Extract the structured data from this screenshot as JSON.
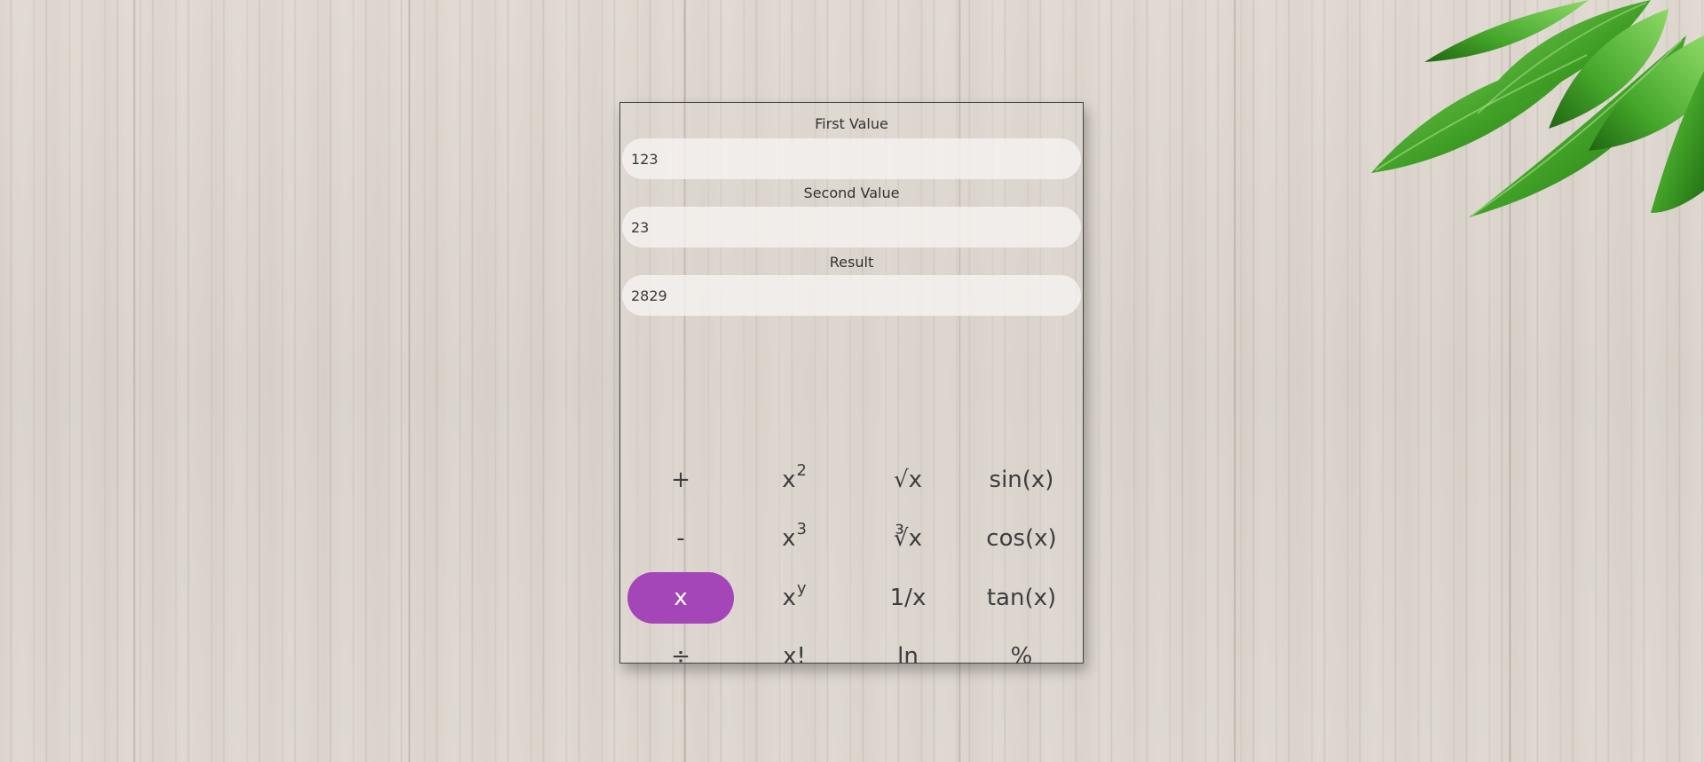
{
  "form": {
    "first_label": "First Value",
    "first_value": "123",
    "second_label": "Second Value",
    "second_value": "23",
    "result_label": "Result",
    "result_value": "2829"
  },
  "operations": [
    {
      "label": "+",
      "sup": ""
    },
    {
      "label": "x",
      "sup": "2"
    },
    {
      "label": "√x",
      "sup": ""
    },
    {
      "label": "sin(x)",
      "sup": ""
    },
    {
      "label": "-",
      "sup": ""
    },
    {
      "label": "x",
      "sup": "3"
    },
    {
      "label": "∛x",
      "sup": ""
    },
    {
      "label": "cos(x)",
      "sup": ""
    },
    {
      "label": "x",
      "sup": ""
    },
    {
      "label": "x",
      "sup": "y"
    },
    {
      "label": "1/x",
      "sup": ""
    },
    {
      "label": "tan(x)",
      "sup": ""
    },
    {
      "label": "÷",
      "sup": ""
    },
    {
      "label": "x!",
      "sup": ""
    },
    {
      "label": "ln",
      "sup": ""
    },
    {
      "label": "%",
      "sup": ""
    }
  ],
  "selected_operation": "x",
  "colors": {
    "accent": "#a445b8",
    "leaf": "#3d9a24"
  }
}
